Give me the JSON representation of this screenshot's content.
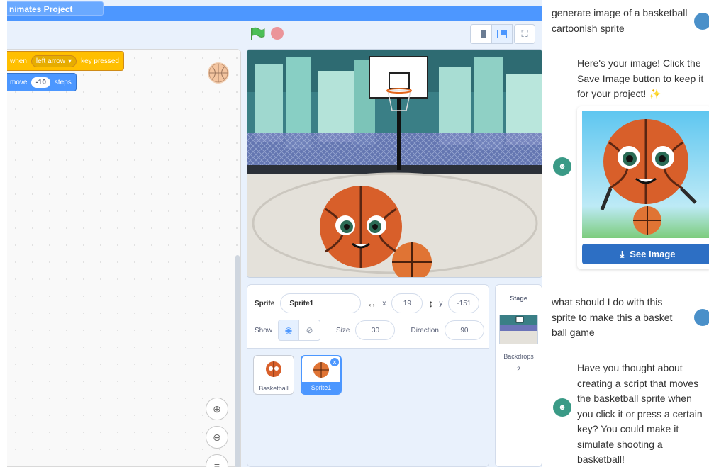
{
  "project": {
    "title": "nimates Project"
  },
  "code": {
    "event_block": {
      "when": "when",
      "key": "left arrow",
      "suffix": "key pressed"
    },
    "motion_block": {
      "label": "move",
      "value": "-10",
      "suffix": "steps"
    },
    "zoom_in_icon": "zoom-in-icon",
    "zoom_out_icon": "zoom-out-icon",
    "zoom_reset_icon": "zoom-reset-icon"
  },
  "controls": {
    "flag_icon": "green-flag-icon",
    "stop_icon": "stop-icon"
  },
  "view_modes": [
    "small-stage-icon",
    "normal-stage-icon",
    "fullscreen-icon"
  ],
  "sprite_info": {
    "sprite_label": "Sprite",
    "sprite_name": "Sprite1",
    "x_label": "x",
    "x_value": "19",
    "y_label": "y",
    "y_value": "-151",
    "show_label": "Show",
    "size_label": "Size",
    "size_value": "30",
    "direction_label": "Direction",
    "direction_value": "90"
  },
  "sprites": [
    {
      "name": "Basketball",
      "selected": false
    },
    {
      "name": "Sprite1",
      "selected": true
    }
  ],
  "stage_pane": {
    "title": "Stage",
    "backdrops_label": "Backdrops",
    "backdrops_count": "2"
  },
  "chat": {
    "messages": [
      {
        "role": "user",
        "text": "generate image of a basketball cartoonish sprite"
      },
      {
        "role": "bot",
        "text": "Here's your image! Click the Save Image button to keep it for your project! ✨"
      },
      {
        "role": "bot-image",
        "button": "See Image"
      },
      {
        "role": "user",
        "text": "what should I do with this sprite to make this a basket ball game"
      },
      {
        "role": "bot",
        "text": "Have you thought about creating a script that moves the basketball sprite when you click it or press a certain key? You could make it simulate shooting a basketball!"
      }
    ]
  },
  "colors": {
    "menubar": "#4d97ff",
    "event_block": "#ffbf00",
    "motion_block": "#4c97ff",
    "selected": "#4c97ff",
    "bot_avatar": "#3a9a86",
    "user_avatar": "#4a90c9",
    "see_button": "#2d6fc4"
  }
}
